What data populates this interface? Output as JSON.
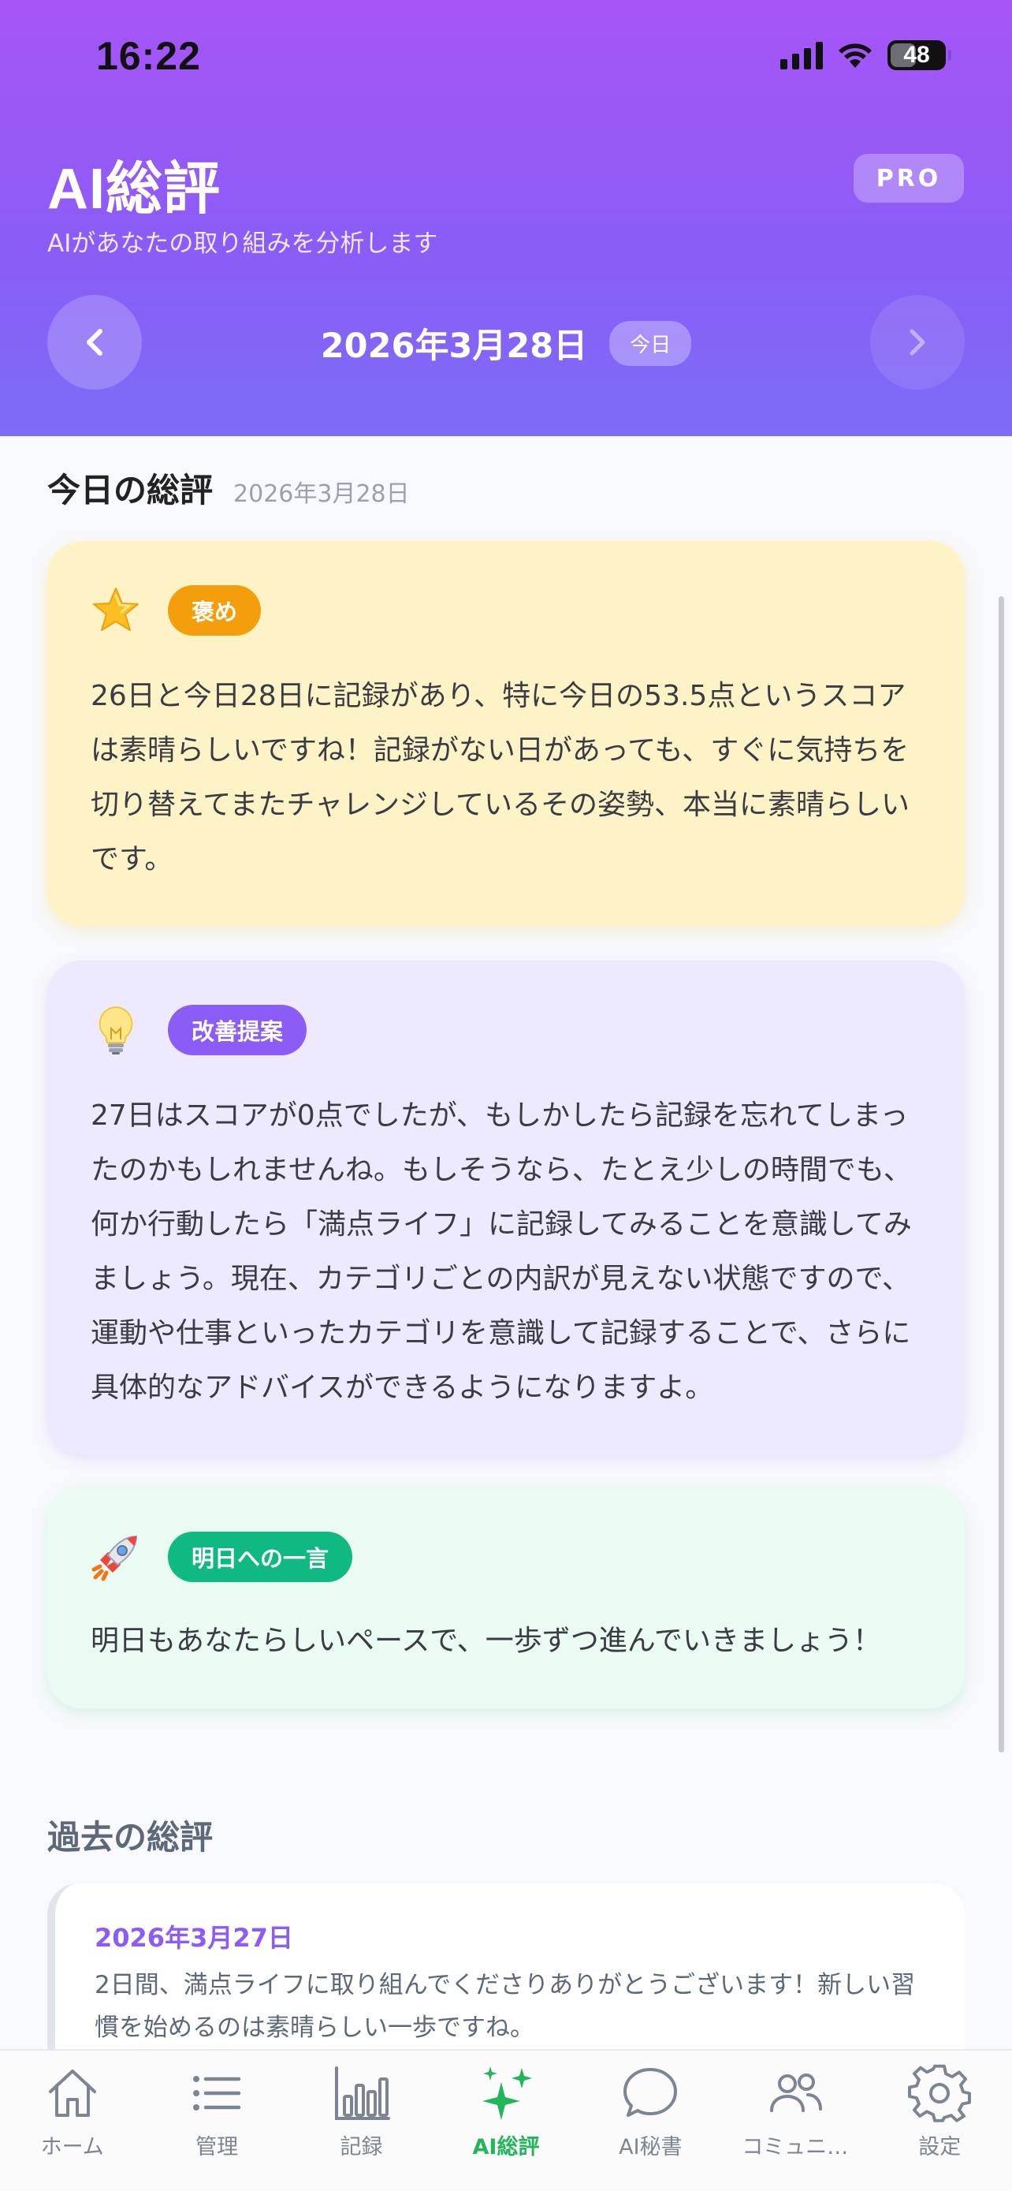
{
  "status_bar": {
    "time": "16:22",
    "battery": "48",
    "battery_level": 0.48
  },
  "header": {
    "title": "AI総評",
    "subtitle": "AIがあなたの取り組みを分析します",
    "pro_badge": "PRO",
    "date": "2026年3月28日",
    "today_badge": "今日",
    "prev_icon": "chevron-left-icon",
    "next_icon": "chevron-right-icon"
  },
  "today_section": {
    "title": "今日の総評",
    "date": "2026年3月28日"
  },
  "cards": [
    {
      "icon": "star-icon",
      "tag": "褒め",
      "color": "#f59e0b",
      "text": "26日と今日28日に記録があり、特に今日の53.5点というスコアは素晴らしいですね！記録がない日があっても、すぐに気持ちを切り替えてまたチャレンジしているその姿勢、本当に素晴らしいです。"
    },
    {
      "icon": "lightbulb-icon",
      "tag": "改善提案",
      "color": "#8b5cf6",
      "text": "27日はスコアが0点でしたが、もしかしたら記録を忘れてしまったのかもしれませんね。もしそうなら、たとえ少しの時間でも、何か行動したら「満点ライフ」に記録してみることを意識してみましょう。現在、カテゴリごとの内訳が見えない状態ですので、運動や仕事といったカテゴリを意識して記録することで、さらに具体的なアドバイスができるようになりますよ。"
    },
    {
      "icon": "rocket-icon",
      "tag": "明日への一言",
      "color": "#10b981",
      "text": "明日もあなたらしいペースで、一歩ずつ進んでいきましょう！"
    }
  ],
  "past_section": {
    "title": "過去の総評",
    "items": [
      {
        "date": "2026年3月27日",
        "text": "2日間、満点ライフに取り組んでくださりありがとうございます！新しい習慣を始めるのは素晴らしい一歩ですね。"
      }
    ]
  },
  "tabbar": {
    "active_color": "#22b55a",
    "items": [
      {
        "label": "ホーム",
        "icon": "home-icon"
      },
      {
        "label": "管理",
        "icon": "list-icon"
      },
      {
        "label": "記録",
        "icon": "bar-chart-icon"
      },
      {
        "label": "AI総評",
        "icon": "sparkles-icon",
        "active": true
      },
      {
        "label": "AI秘書",
        "icon": "chat-bubble-icon"
      },
      {
        "label": "コミュニ…",
        "icon": "people-icon"
      },
      {
        "label": "設定",
        "icon": "gear-icon"
      }
    ]
  }
}
